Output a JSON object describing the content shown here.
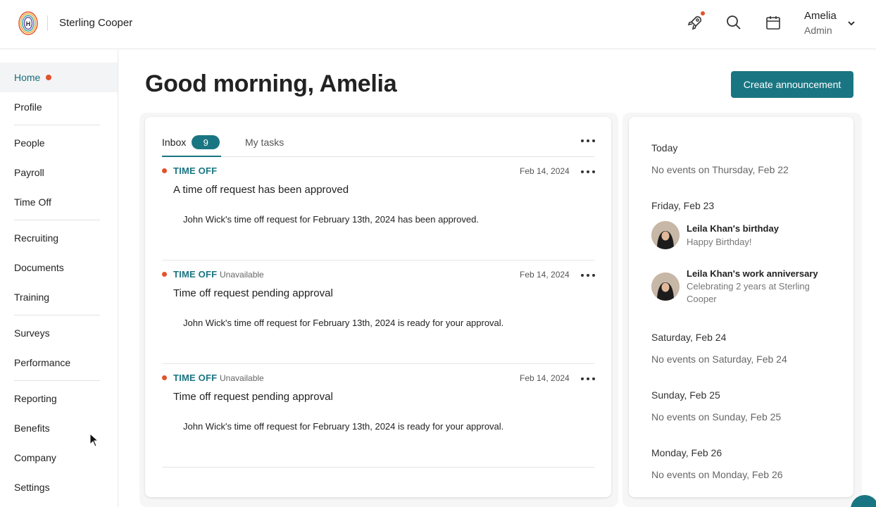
{
  "header": {
    "company": "Sterling Cooper",
    "user_name": "Amelia",
    "user_role": "Admin"
  },
  "sidebar": {
    "items": [
      {
        "label": "Home"
      },
      {
        "label": "Profile"
      },
      {
        "label": "People"
      },
      {
        "label": "Payroll"
      },
      {
        "label": "Time Off"
      },
      {
        "label": "Recruiting"
      },
      {
        "label": "Documents"
      },
      {
        "label": "Training"
      },
      {
        "label": "Surveys"
      },
      {
        "label": "Performance"
      },
      {
        "label": "Reporting"
      },
      {
        "label": "Benefits"
      },
      {
        "label": "Company"
      },
      {
        "label": "Settings"
      }
    ]
  },
  "main": {
    "greeting": "Good morning, Amelia",
    "create_button": "Create announcement"
  },
  "inbox": {
    "tab_inbox": "Inbox",
    "inbox_count": "9",
    "tab_tasks": "My tasks",
    "items": [
      {
        "category": "TIME OFF",
        "status": "",
        "date": "Feb 14, 2024",
        "title": "A time off request has been approved",
        "body": "John Wick's time off request for February 13th, 2024 has been approved."
      },
      {
        "category": "TIME OFF",
        "status": "Unavailable",
        "date": "Feb 14, 2024",
        "title": "Time off request pending approval",
        "body": "John Wick's time off request for February 13th, 2024 is ready for your approval."
      },
      {
        "category": "TIME OFF",
        "status": "Unavailable",
        "date": "Feb 14, 2024",
        "title": "Time off request pending approval",
        "body": "John Wick's time off request for February 13th, 2024 is ready for your approval."
      }
    ]
  },
  "calendar": {
    "today_label": "Today",
    "today_none": "No events on Thursday, Feb 22",
    "fri_label": "Friday, Feb 23",
    "events": [
      {
        "title": "Leila Khan's birthday",
        "subtitle": "Happy Birthday!"
      },
      {
        "title": "Leila Khan's work anniversary",
        "subtitle": "Celebrating 2 years at Sterling Cooper"
      }
    ],
    "sat_label": "Saturday, Feb 24",
    "sat_none": "No events on Saturday, Feb 24",
    "sun_label": "Sunday, Feb 25",
    "sun_none": "No events on Sunday, Feb 25",
    "mon_label": "Monday, Feb 26",
    "mon_none": "No events on Monday, Feb 26"
  },
  "colors": {
    "accent": "#1a7582",
    "notification": "#e2532b"
  },
  "icons": [
    "logo-icon",
    "rocket-icon",
    "search-icon",
    "calendar-icon",
    "chevron-down-icon",
    "more-icon"
  ]
}
